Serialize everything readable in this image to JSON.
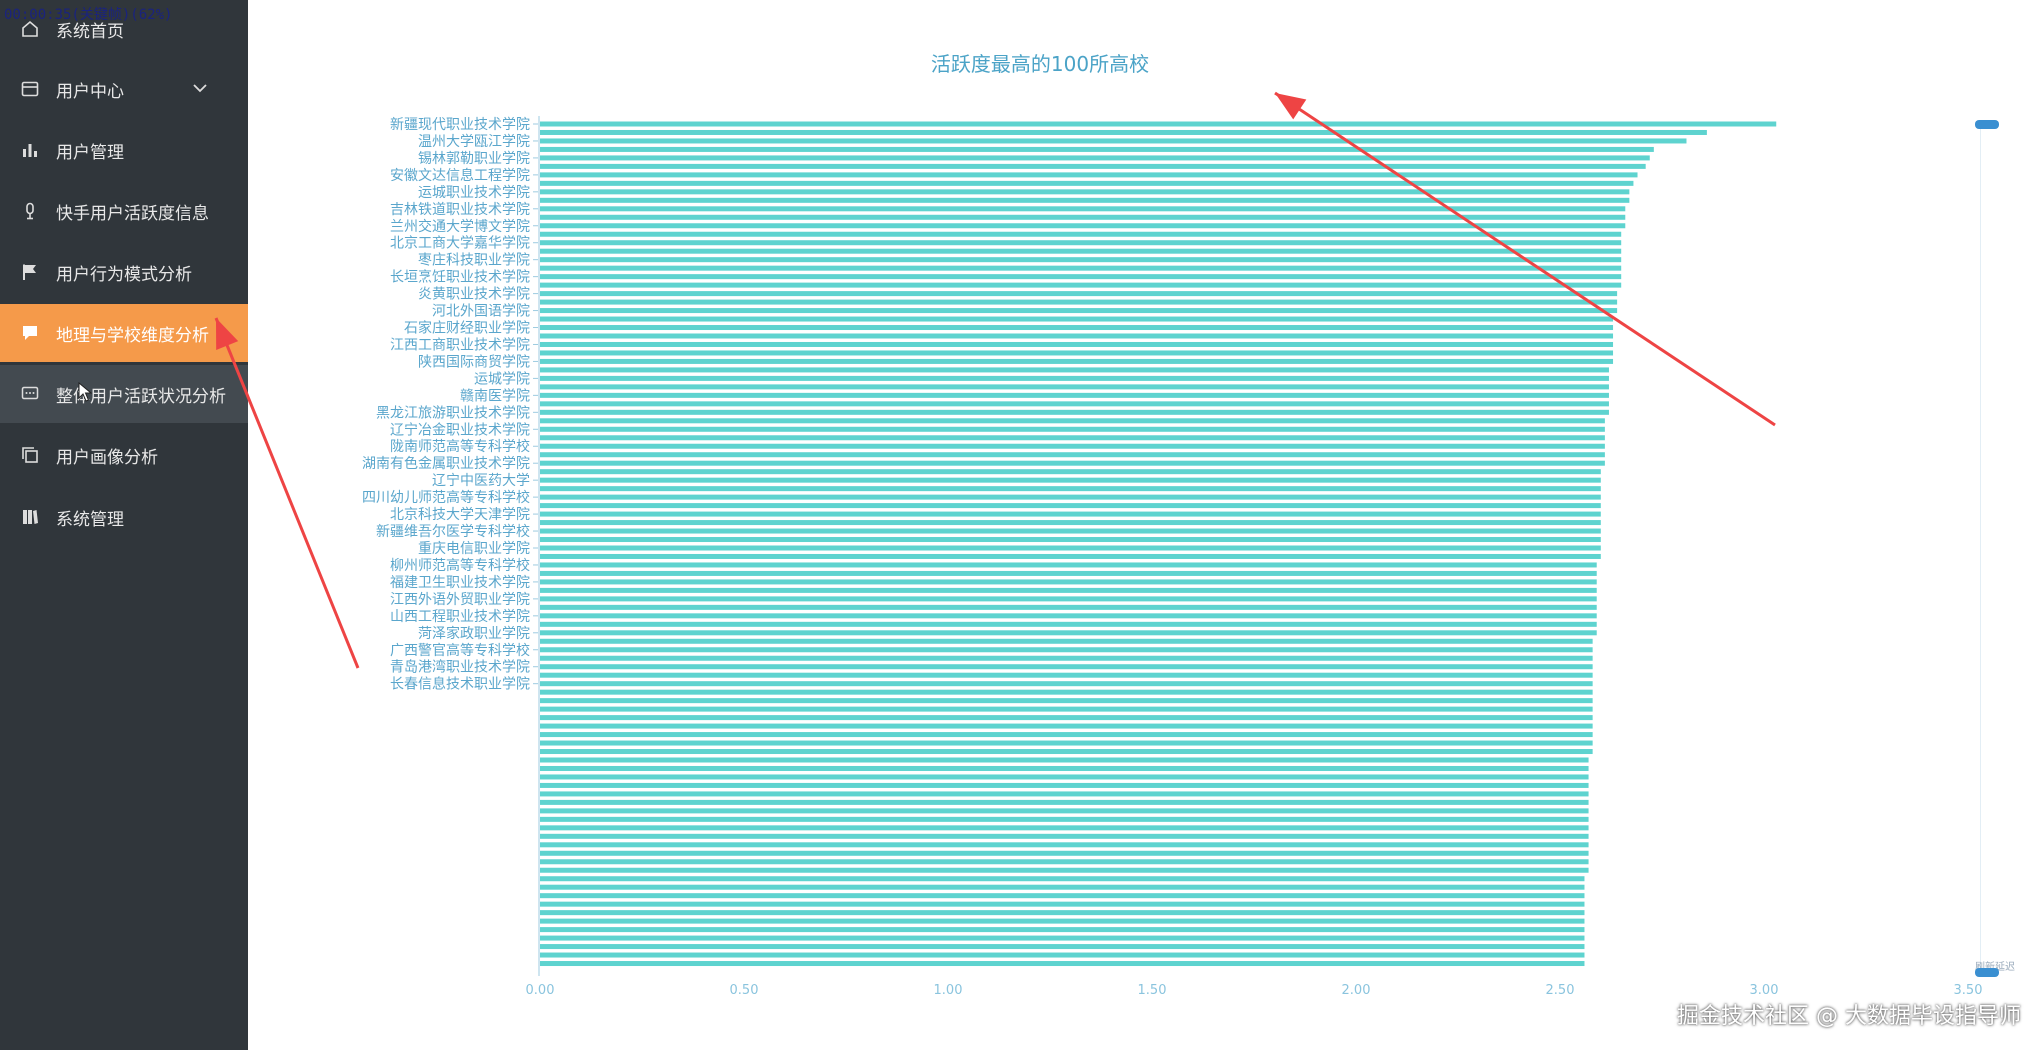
{
  "overlay": {
    "timer": "00:00:35(关键帧)(62%)"
  },
  "sidebar": {
    "items": [
      {
        "label": "系统首页",
        "icon": "home-icon"
      },
      {
        "label": "用户中心",
        "icon": "user-card-icon",
        "expand": true
      },
      {
        "label": "用户管理",
        "icon": "bar-chart-icon"
      },
      {
        "label": "快手用户活跃度信息",
        "icon": "microphone-icon"
      },
      {
        "label": "用户行为模式分析",
        "icon": "flag-icon"
      },
      {
        "label": "地理与学校维度分析",
        "icon": "comment-icon",
        "active": true
      },
      {
        "label": "整体用户活跃状况分析",
        "icon": "chat-dots-icon",
        "hover": true
      },
      {
        "label": "用户画像分析",
        "icon": "copy-icon"
      },
      {
        "label": "系统管理",
        "icon": "book-icon"
      }
    ]
  },
  "watermark": "掘金技术社区 @ 大数据毕设指导师",
  "slider": {
    "bottom_label": "刷新延迟"
  },
  "colors": {
    "bar": "#5ed3cf",
    "axis_text": "#5aa6cc",
    "active_menu": "#f59a4a",
    "arrow": "#ee4444"
  },
  "chart_data": {
    "type": "bar",
    "orientation": "horizontal",
    "title": "活跃度最高的100所高校",
    "xlim": [
      0,
      3.5
    ],
    "x_ticks": [
      "0.00",
      "0.50",
      "1.00",
      "1.50",
      "2.00",
      "2.50",
      "3.00",
      "3.50"
    ],
    "categories": [
      "新疆现代职业技术学院",
      "",
      "温州大学瓯江学院",
      "",
      "锡林郭勒职业学院",
      "",
      "安徽文达信息工程学院",
      "",
      "运城职业技术学院",
      "",
      "吉林铁道职业技术学院",
      "",
      "兰州交通大学博文学院",
      "",
      "北京工商大学嘉华学院",
      "",
      "枣庄科技职业学院",
      "",
      "长垣烹饪职业技术学院",
      "",
      "炎黄职业技术学院",
      "",
      "河北外国语学院",
      "",
      "石家庄财经职业学院",
      "",
      "江西工商职业技术学院",
      "",
      "陕西国际商贸学院",
      "",
      "运城学院",
      "",
      "赣南医学院",
      "",
      "黑龙江旅游职业技术学院",
      "",
      "辽宁冶金职业技术学院",
      "",
      "陇南师范高等专科学校",
      "",
      "湖南有色金属职业技术学院",
      "",
      "辽宁中医药大学",
      "",
      "四川幼儿师范高等专科学校",
      "",
      "北京科技大学天津学院",
      "",
      "新疆维吾尔医学专科学校",
      "",
      "重庆电信职业学院",
      "",
      "柳州师范高等专科学校",
      "",
      "福建卫生职业技术学院",
      "",
      "江西外语外贸职业学院",
      "",
      "山西工程职业技术学院",
      "",
      "菏泽家政职业学院",
      "",
      "广西警官高等专科学校",
      "",
      "青岛港湾职业技术学院",
      "",
      "长春信息技术职业学院"
    ],
    "values": [
      3.03,
      2.86,
      2.81,
      2.73,
      2.72,
      2.71,
      2.69,
      2.68,
      2.67,
      2.67,
      2.66,
      2.66,
      2.66,
      2.65,
      2.65,
      2.65,
      2.65,
      2.65,
      2.65,
      2.65,
      2.64,
      2.64,
      2.64,
      2.63,
      2.63,
      2.63,
      2.63,
      2.63,
      2.63,
      2.62,
      2.62,
      2.62,
      2.62,
      2.62,
      2.62,
      2.61,
      2.61,
      2.61,
      2.61,
      2.61,
      2.61,
      2.6,
      2.6,
      2.6,
      2.6,
      2.6,
      2.6,
      2.6,
      2.6,
      2.6,
      2.6,
      2.6,
      2.59,
      2.59,
      2.59,
      2.59,
      2.59,
      2.59,
      2.59,
      2.59,
      2.59,
      2.58,
      2.58,
      2.58,
      2.58,
      2.58,
      2.58,
      2.58,
      2.58,
      2.58,
      2.58,
      2.58,
      2.58,
      2.58,
      2.58,
      2.57,
      2.57,
      2.57,
      2.57,
      2.57,
      2.57,
      2.57,
      2.57,
      2.57,
      2.57,
      2.57,
      2.57,
      2.57,
      2.57,
      2.56,
      2.56,
      2.56,
      2.56,
      2.56,
      2.56,
      2.56,
      2.56,
      2.56,
      2.56,
      2.56
    ]
  }
}
